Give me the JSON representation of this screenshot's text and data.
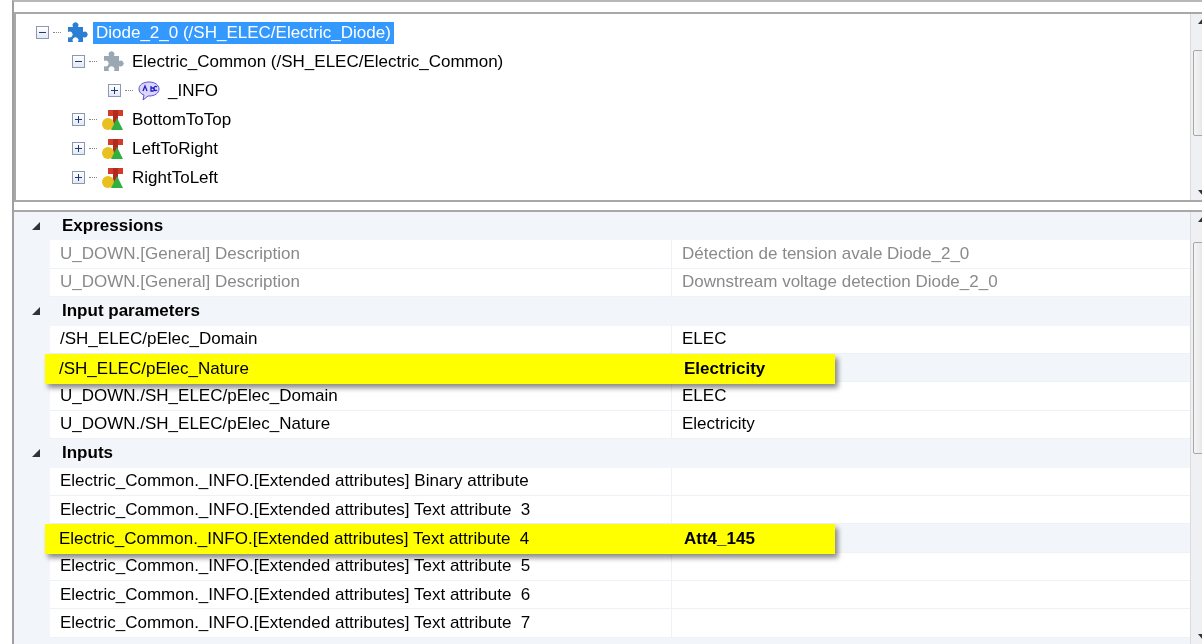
{
  "tree": [
    {
      "label": "Diode_2_0 (/SH_ELEC/Electric_Diode)",
      "kind": "component",
      "selected": true,
      "expanded": true,
      "children": [
        {
          "label": "Electric_Common (/SH_ELEC/Electric_Common)",
          "kind": "subcomponent",
          "selected": false,
          "expanded": true,
          "children": [
            {
              "label": "_INFO",
              "kind": "text",
              "selected": false,
              "expanded": false
            }
          ]
        },
        {
          "label": "BottomToTop",
          "kind": "shapes",
          "selected": false,
          "expanded": false
        },
        {
          "label": "LeftToRight",
          "kind": "shapes",
          "selected": false,
          "expanded": false
        },
        {
          "label": "RightToLeft",
          "kind": "shapes",
          "selected": false,
          "expanded": false
        }
      ]
    }
  ],
  "properties": [
    {
      "category": "Expressions",
      "expanded": true,
      "rows": [
        {
          "name": "U_DOWN.[General] Description",
          "value": "Détection de tension avale Diode_2_0",
          "disabled": true,
          "highlighted": false
        },
        {
          "name": "U_DOWN.[General] Description",
          "value": "Downstream voltage detection Diode_2_0",
          "disabled": true,
          "highlighted": false
        }
      ]
    },
    {
      "category": "Input parameters",
      "expanded": true,
      "rows": [
        {
          "name": "/SH_ELEC/pElec_Domain",
          "value": "ELEC",
          "disabled": false,
          "highlighted": false
        },
        {
          "name": "/SH_ELEC/pElec_Nature",
          "value": "Electricity",
          "disabled": false,
          "highlighted": true
        },
        {
          "name": "U_DOWN./SH_ELEC/pElec_Domain",
          "value": "ELEC",
          "disabled": false,
          "highlighted": false
        },
        {
          "name": "U_DOWN./SH_ELEC/pElec_Nature",
          "value": "Electricity",
          "disabled": false,
          "highlighted": false
        }
      ]
    },
    {
      "category": "Inputs",
      "expanded": true,
      "rows": [
        {
          "name": "Electric_Common._INFO.[Extended attributes] Binary attribute",
          "disabled": false,
          "highlighted": false
        },
        {
          "name": "Electric_Common._INFO.[Extended attributes] Text attribute  3",
          "disabled": false,
          "highlighted": false
        },
        {
          "name": "Electric_Common._INFO.[Extended attributes] Text attribute  4",
          "value": "Att4_145",
          "disabled": false,
          "highlighted": true
        },
        {
          "name": "Electric_Common._INFO.[Extended attributes] Text attribute  5",
          "disabled": false,
          "highlighted": false
        },
        {
          "name": "Electric_Common._INFO.[Extended attributes] Text attribute  6",
          "disabled": false,
          "highlighted": false
        },
        {
          "name": "Electric_Common._INFO.[Extended attributes] Text attribute  7",
          "disabled": false,
          "highlighted": false
        }
      ]
    }
  ]
}
